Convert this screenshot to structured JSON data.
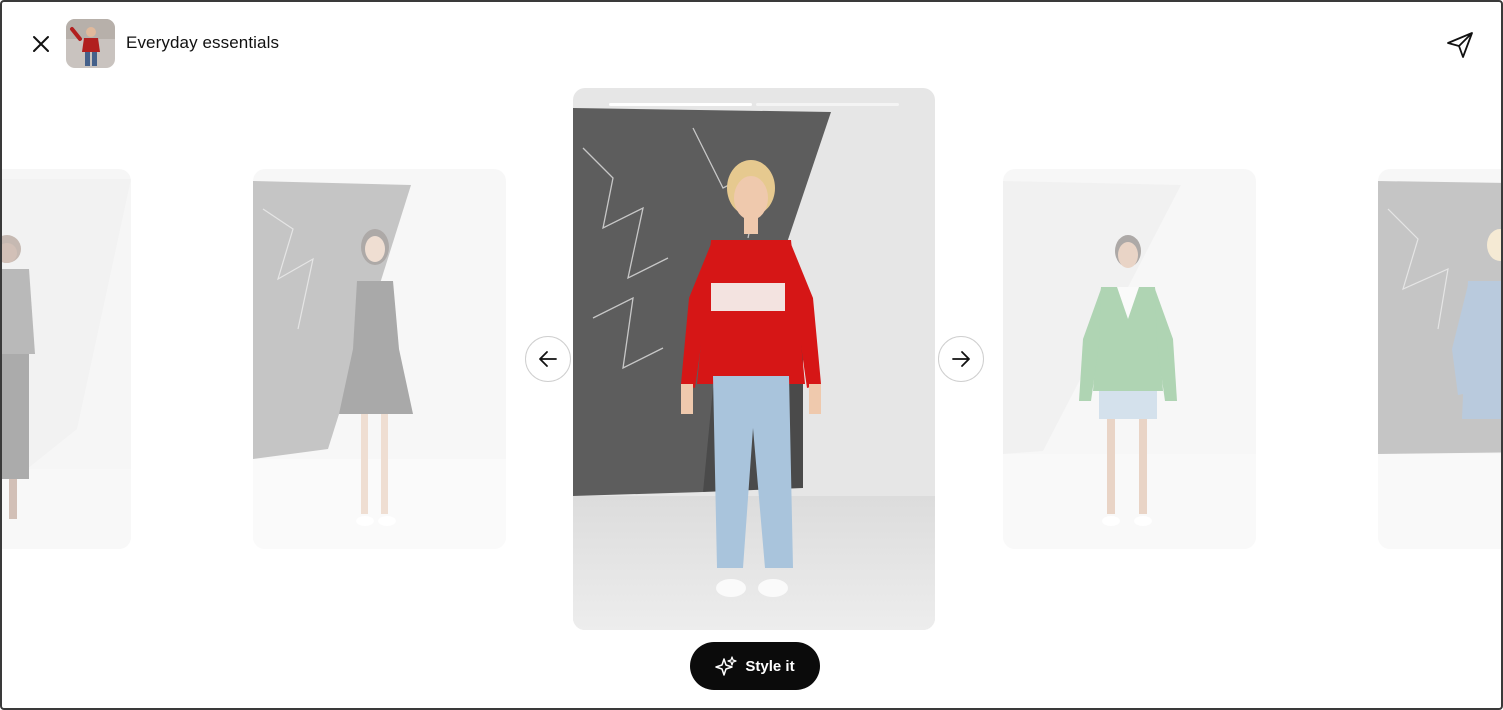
{
  "header": {
    "collection_title": "Everyday essentials",
    "close_icon": "close-icon",
    "share_icon": "send-icon"
  },
  "carousel": {
    "progress": {
      "segments": 2,
      "active_index": 0
    },
    "cards": [
      {
        "position": "far-left",
        "outfit": "grey sweater, black skirt",
        "model": "curly dark hair"
      },
      {
        "position": "left",
        "outfit": "black sleeveless dress",
        "model": "long dark hair"
      },
      {
        "position": "center",
        "outfit": "red sweater with white stripe, light-wash jeans",
        "model": "blonde hair"
      },
      {
        "position": "right",
        "outfit": "green v-neck sweater, denim shorts",
        "model": "dark hair in bun"
      },
      {
        "position": "far-right",
        "outfit": "denim shirt dress",
        "model": "blonde hair"
      }
    ],
    "prev_icon": "arrow-left-icon",
    "next_icon": "arrow-right-icon"
  },
  "actions": {
    "style_label": "Style it",
    "style_icon": "sparkle-icon"
  },
  "colors": {
    "accent_button": "#0b0b0b",
    "red_sweater": "#d61616",
    "green_sweater": "#2f8f3a",
    "jeans": "#a9c4dc"
  }
}
